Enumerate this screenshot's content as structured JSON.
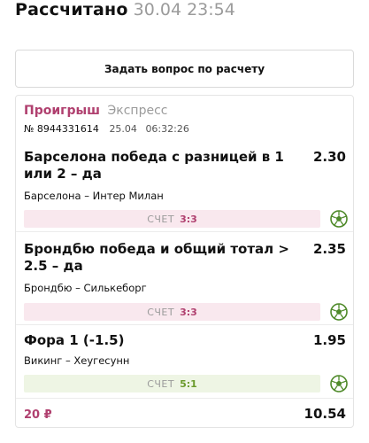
{
  "header": {
    "status_label": "Рассчитано",
    "datetime": "30.04 23:54"
  },
  "ask_button": {
    "label": "Задать вопрос по расчету"
  },
  "bet": {
    "result": "Проигрыш",
    "type": "Экспресс",
    "number": "№ 8944331614",
    "date": "25.04",
    "time": "06:32:26",
    "events": [
      {
        "name": "Барселона победа с разницей в 1 или 2 – да",
        "coef": "2.30",
        "match": "Барселона – Интер Милан",
        "score_label": "СЧЕТ",
        "score": "3:3",
        "outcome": "lose"
      },
      {
        "name": "Брондбю победа и общий тотал > 2.5 – да",
        "coef": "2.35",
        "match": "Брондбю – Силькеборг",
        "score_label": "СЧЕТ",
        "score": "3:3",
        "outcome": "lose"
      },
      {
        "name": "Фора 1 (-1.5)",
        "coef": "1.95",
        "match": "Викинг – Хеугесунн",
        "score_label": "СЧЕТ",
        "score": "5:1",
        "outcome": "win"
      }
    ],
    "stake": "20 ₽",
    "total_coef": "10.54"
  },
  "icons": {
    "sport": "soccer-ball-icon"
  },
  "colors": {
    "lose": "#b0406f",
    "win": "#6b9a2c",
    "ball": "#4f8a2a"
  }
}
